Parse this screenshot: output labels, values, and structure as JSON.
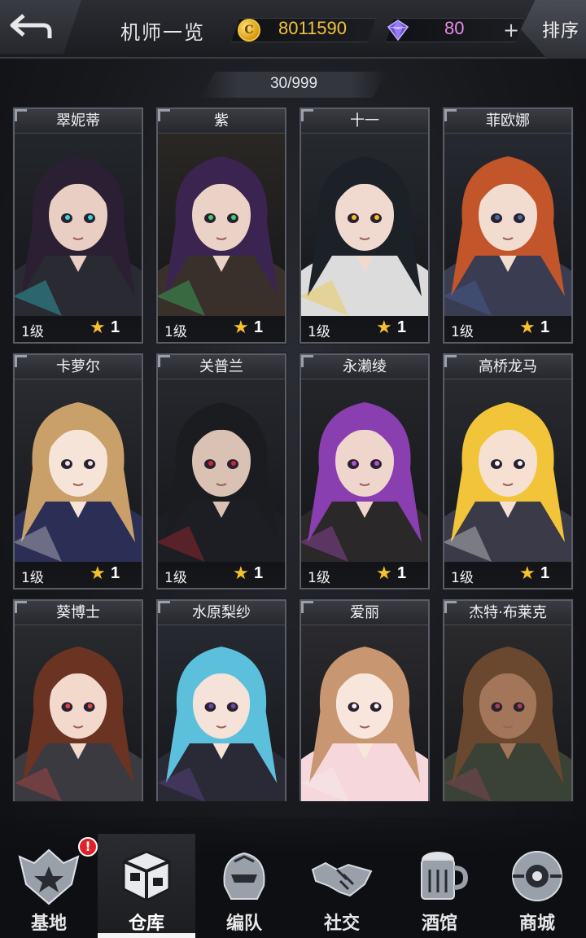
{
  "header": {
    "title": "机师一览",
    "coins": "8011590",
    "gems": "80",
    "gem_plus": "+",
    "coin_glyph": "C",
    "sort_label": "排序"
  },
  "roster": {
    "count": "30/999"
  },
  "cards": [
    {
      "name": "翠妮蒂",
      "level": "1级",
      "stars": "1",
      "hair": "#2b1f33",
      "skin": "#e9cfc3",
      "outfit": "#2a2a33",
      "accent": "#30d8d8",
      "bg": "#23262b"
    },
    {
      "name": "紫",
      "level": "1级",
      "stars": "1",
      "hair": "#3b2450",
      "skin": "#ebd2c6",
      "outfit": "#3a302b",
      "accent": "#3ad36b",
      "bg": "#2a2724"
    },
    {
      "name": "十一",
      "level": "1级",
      "stars": "1",
      "hair": "#1c2128",
      "skin": "#f0dad0",
      "outfit": "#dcdcdc",
      "accent": "#f2c21e",
      "bg": "#262a2e"
    },
    {
      "name": "菲欧娜",
      "level": "1级",
      "stars": "1",
      "hair": "#c2552a",
      "skin": "#f2dccf",
      "outfit": "#3a3c52",
      "accent": "#4b6aa8",
      "bg": "#262931"
    },
    {
      "name": "卡萝尔",
      "level": "1级",
      "stars": "1",
      "hair": "#caa06a",
      "skin": "#f6e4d8",
      "outfit": "#2c2f55",
      "accent": "#e9e4df",
      "bg": "#2a2b30"
    },
    {
      "name": "关普兰",
      "level": "1级",
      "stars": "1",
      "hair": "#1b1c20",
      "skin": "#d9c2b4",
      "outfit": "#1d1e23",
      "accent": "#c92a35",
      "bg": "#25272c"
    },
    {
      "name": "永濑绫",
      "level": "1级",
      "stars": "1",
      "hair": "#8a3fb0",
      "skin": "#efd6cc",
      "outfit": "#2b2829",
      "accent": "#b74fd2",
      "bg": "#242528"
    },
    {
      "name": "高桥龙马",
      "level": "1级",
      "stars": "1",
      "hair": "#f2c43a",
      "skin": "#f6e0d2",
      "outfit": "#3a3a48",
      "accent": "#f5f5f5",
      "bg": "#282a2f"
    },
    {
      "name": "葵博士",
      "level": "",
      "stars": "",
      "hair": "#6a3322",
      "skin": "#f2d9cc",
      "outfit": "#3a3a40",
      "accent": "#d84a46",
      "bg": "#282a2e"
    },
    {
      "name": "水原梨纱",
      "level": "",
      "stars": "",
      "hair": "#5cc0dc",
      "skin": "#f5e2d8",
      "outfit": "#2a2a36",
      "accent": "#6a4aa0",
      "bg": "#262a30"
    },
    {
      "name": "爱丽",
      "level": "",
      "stars": "",
      "hair": "#c89670",
      "skin": "#f8e6dc",
      "outfit": "#f6d8dc",
      "accent": "#f4f4f4",
      "bg": "#2b2a2e"
    },
    {
      "name": "杰特·布莱克",
      "level": "",
      "stars": "",
      "hair": "#6a4830",
      "skin": "#a3765a",
      "outfit": "#3a4235",
      "accent": "#a0445a",
      "bg": "#2a2a2c"
    }
  ],
  "nav": [
    {
      "label": "基地",
      "icon": "base-emblem-icon",
      "badge": "!"
    },
    {
      "label": "仓库",
      "icon": "warehouse-crate-icon",
      "badge": ""
    },
    {
      "label": "编队",
      "icon": "formation-helmet-icon",
      "badge": ""
    },
    {
      "label": "社交",
      "icon": "handshake-icon",
      "badge": ""
    },
    {
      "label": "酒馆",
      "icon": "tavern-beer-icon",
      "badge": ""
    },
    {
      "label": "商城",
      "icon": "shop-orb-icon",
      "badge": ""
    }
  ],
  "colors": {
    "coin": "#f0c23c",
    "gem": "#e78ae8",
    "star": "#f5c22a",
    "badge": "#e1202a"
  }
}
